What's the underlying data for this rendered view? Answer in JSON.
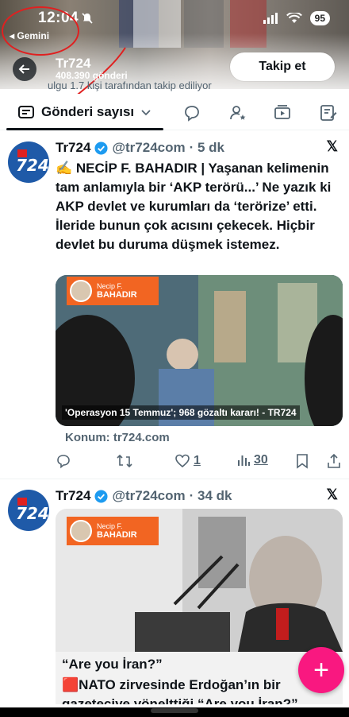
{
  "status_bar": {
    "time": "12:04",
    "back_app": "◂ Gemini",
    "battery": "95"
  },
  "profile_header": {
    "title": "Tr724",
    "posts_count": "408.390 gönderi",
    "follow_label": "Takip et",
    "peek_text": "ulgu 1.7 kişi tarafından takip ediliyor"
  },
  "tabs": {
    "active_label": "Gönderi sayısı",
    "icons": [
      "comment-icon",
      "person-star-icon",
      "video-icon",
      "article-icon"
    ]
  },
  "tweets": [
    {
      "name": "Tr724",
      "handle": "@tr724com",
      "time": "· 5 dk",
      "text": "✍️ NECİP F. BAHADIR | Yaşanan kelimenin tam anlamıyla bir ‘AKP terörü...’ Ne yazık ki AKP devlet ve kurumları da ‘terörize’ etti. İleride bunun çok acısını çekecek. Hiçbir devlet bu duruma düşmek istemez.",
      "media_badge_name": "Necip F.",
      "media_badge_surname": "BAHADIR",
      "media_caption": "'Operasyon 15 Temmuz'; 968 gözaltı kararı! - TR724",
      "location": "Konum: tr724.com",
      "likes": "1",
      "views": "30"
    },
    {
      "name": "Tr724",
      "handle": "@tr724com",
      "time": "· 34 dk",
      "media_badge_name": "Necip F.",
      "media_badge_surname": "BAHADIR",
      "quote_title": "“Are you İran?”",
      "text": "🟥NATO zirvesinde Erdoğan’ın bir gazeteciye yönelttiği “Are you  İran?” sorusu, toplantının en çok konuşulan"
    }
  ],
  "fab_label": "+"
}
